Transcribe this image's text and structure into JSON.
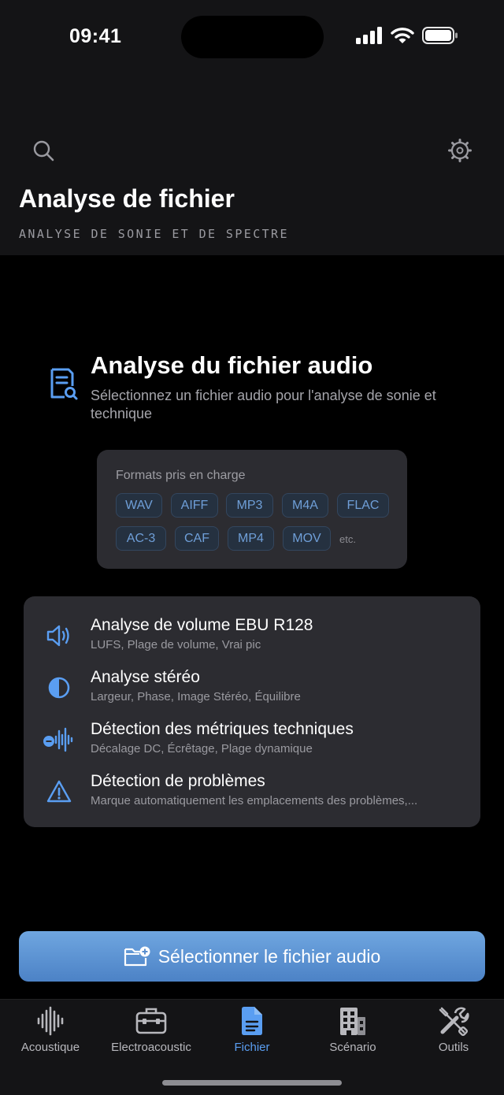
{
  "status": {
    "time": "09:41"
  },
  "header": {
    "title": "Analyse de fichier",
    "subtitle": "ANALYSE DE SONIE ET DE SPECTRE",
    "left_icon": "search-icon",
    "right_icon": "gear-icon"
  },
  "intro": {
    "icon": "document-search-icon",
    "title": "Analyse du fichier audio",
    "description": "Sélectionnez un fichier audio pour l'analyse de sonie et technique"
  },
  "formats": {
    "title": "Formats pris en charge",
    "items": [
      "WAV",
      "AIFF",
      "MP3",
      "M4A",
      "FLAC",
      "AC-3",
      "CAF",
      "MP4",
      "MOV"
    ],
    "more": "etc."
  },
  "features": [
    {
      "icon": "speaker-wave-icon",
      "title": "Analyse de volume EBU R128",
      "desc": "LUFS, Plage de volume, Vrai pic"
    },
    {
      "icon": "half-circle-icon",
      "title": "Analyse stéréo",
      "desc": "Largeur, Phase, Image Stéréo, Équilibre"
    },
    {
      "icon": "waveform-minus-icon",
      "title": "Détection des métriques techniques",
      "desc": "Décalage DC, Écrêtage, Plage dynamique"
    },
    {
      "icon": "warning-icon",
      "title": "Détection de problèmes",
      "desc": "Marque automatiquement les emplacements des problèmes,..."
    }
  ],
  "select_button": {
    "icon": "folder-plus-icon",
    "label": "Sélectionner le fichier audio"
  },
  "tabs": [
    {
      "label": "Acoustique",
      "icon": "waveform-icon"
    },
    {
      "label": "Electroacoustic",
      "icon": "toolbox-icon"
    },
    {
      "label": "Fichier",
      "icon": "document-icon",
      "active": true
    },
    {
      "label": "Scénario",
      "icon": "building-icon"
    },
    {
      "label": "Outils",
      "icon": "tools-icon"
    }
  ],
  "colors": {
    "accent": "#5a9ef2",
    "card": "#2c2c31",
    "header_bg": "#141416",
    "button_top": "#6fa6e0",
    "button_bottom": "#4c82c6"
  }
}
